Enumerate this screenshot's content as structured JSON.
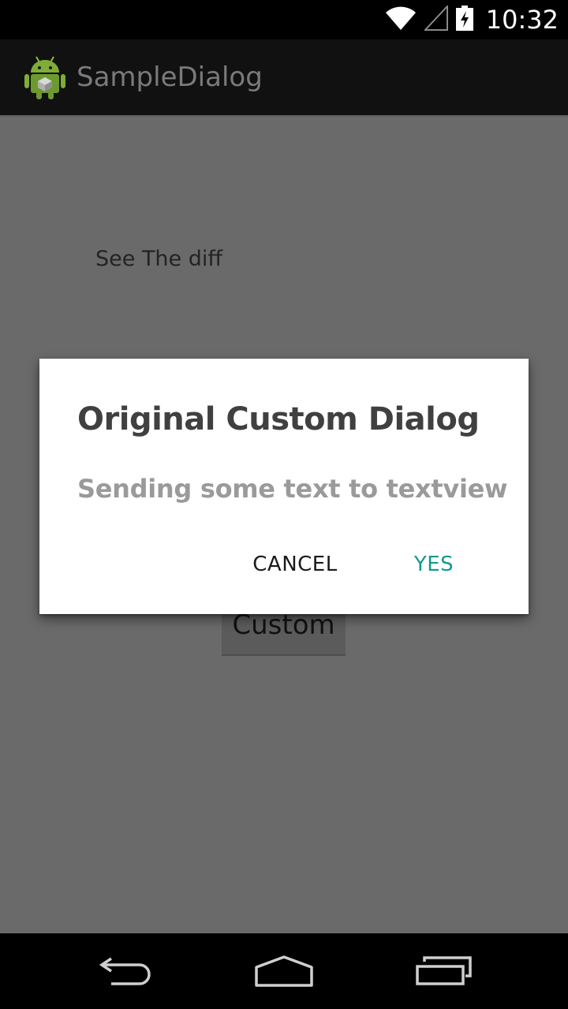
{
  "status_bar": {
    "time": "10:32",
    "icons": [
      "wifi-icon",
      "cell-signal-icon",
      "battery-charging-icon"
    ]
  },
  "action_bar": {
    "app_icon": "android-icon",
    "title": "SampleDialog"
  },
  "content": {
    "text": "See The diff",
    "button_label": "Custom"
  },
  "dialog": {
    "title": "Original Custom Dialog",
    "message": "Sending some text to textview",
    "cancel_label": "CANCEL",
    "yes_label": "YES"
  },
  "nav_bar": {
    "icons": [
      "back-icon",
      "home-icon",
      "recents-icon"
    ]
  },
  "colors": {
    "accent": "#119a8d",
    "scrim_background": "#6a6a6a",
    "action_bar": "#111111",
    "dialog_background": "#ffffff"
  }
}
